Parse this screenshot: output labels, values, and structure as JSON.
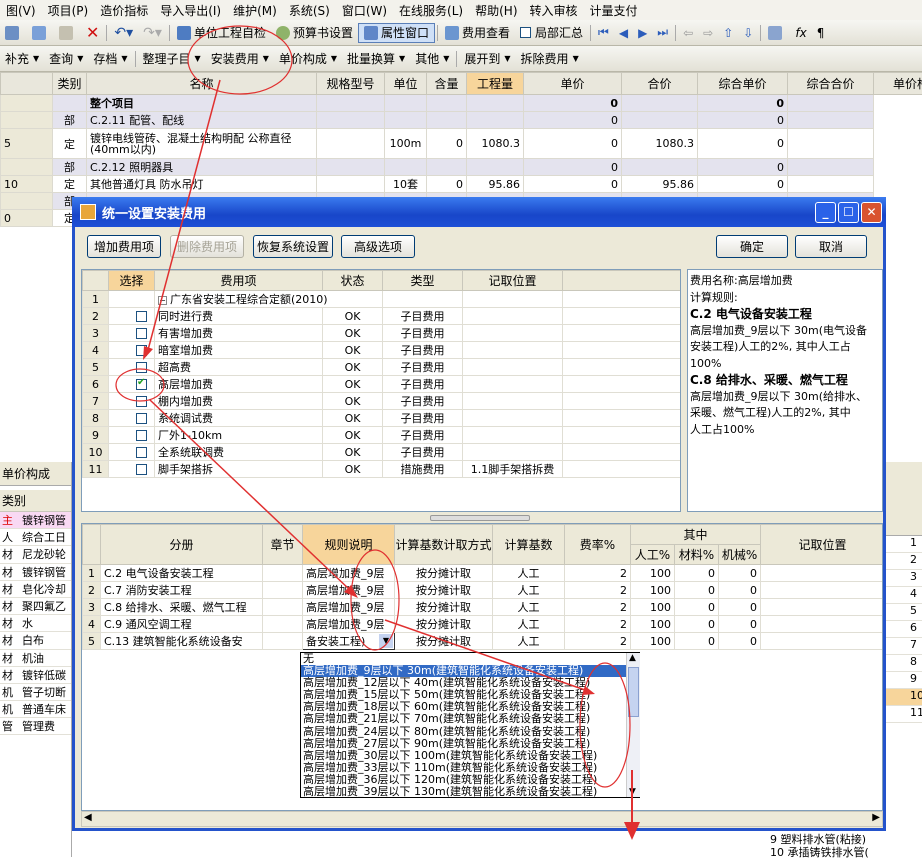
{
  "menu": [
    "图(V)",
    "项目(P)",
    "造价指标",
    "导入导出(I)",
    "维护(M)",
    "系统(S)",
    "窗口(W)",
    "在线服务(L)",
    "帮助(H)",
    "转入审核",
    "计量支付"
  ],
  "toolbar1": {
    "self_check": "单位工程自检",
    "budget_settings": "预算书设置",
    "property_window": "属性窗口",
    "fee_view": "费用查看",
    "local_summary": "局部汇总"
  },
  "toolbar2": {
    "items": [
      "补充",
      "查询",
      "存档",
      "整理子目",
      "安装费用",
      "单价构成",
      "批量换算",
      "其他",
      "展开到",
      "拆除费用"
    ]
  },
  "main_table": {
    "headers": [
      "类别",
      "名称",
      "规格型号",
      "单位",
      "含量",
      "工程量",
      "单价",
      "合价",
      "综合单价",
      "综合合价",
      "单价构成"
    ],
    "rows": [
      {
        "no": "",
        "cat": "",
        "name": "整个项目",
        "spec": "",
        "unit": "",
        "qty": "",
        "price": "",
        "total": "0",
        "cprice": "",
        "ctotal": "0",
        "bold": true
      },
      {
        "no": "",
        "cat": "部",
        "name": "C.2.11 配管、配线",
        "spec": "",
        "unit": "",
        "qty": "",
        "price": "",
        "total": "0",
        "cprice": "",
        "ctotal": "0"
      },
      {
        "no": "5",
        "cat": "定",
        "name": "镀锌电线管砖、混凝土结构明配 公称直径(40mm以内)",
        "spec": "",
        "unit": "100m",
        "qty": "0",
        "price": "1080.3",
        "total": "0",
        "cprice": "1080.3",
        "ctotal": "0"
      },
      {
        "no": "",
        "cat": "部",
        "name": "C.2.12 照明器具",
        "spec": "",
        "unit": "",
        "qty": "",
        "price": "",
        "total": "0",
        "cprice": "",
        "ctotal": "0"
      },
      {
        "no": "10",
        "cat": "定",
        "name": "其他普通灯具 防水吊灯",
        "spec": "",
        "unit": "10套",
        "qty": "0",
        "price": "95.86",
        "total": "0",
        "cprice": "95.86",
        "ctotal": "0"
      },
      {
        "no": "",
        "cat": "部",
        "name": "",
        "spec": "",
        "unit": "",
        "qty": "",
        "price": "",
        "total": "",
        "cprice": "",
        "ctotal": ""
      },
      {
        "no": "0",
        "cat": "定",
        "name": "",
        "spec": "",
        "unit": "",
        "qty": "",
        "price": "",
        "total": "",
        "cprice": "",
        "ctotal": ""
      }
    ]
  },
  "left_panel": {
    "tab": "单价构成",
    "header": "类别",
    "rows": [
      [
        "主",
        "镀锌钢管"
      ],
      [
        "人",
        "综合工日"
      ],
      [
        "材",
        "尼龙砂轮"
      ],
      [
        "材",
        "镀锌钢管"
      ],
      [
        "材",
        "皂化冷却"
      ],
      [
        "材",
        "聚四氟乙"
      ],
      [
        "材",
        "水"
      ],
      [
        "材",
        "白布"
      ],
      [
        "材",
        "机油"
      ],
      [
        "材",
        "镀锌低碳"
      ],
      [
        "机",
        "管子切断"
      ],
      [
        "机",
        "普通车床"
      ],
      [
        "管",
        "管理费"
      ]
    ]
  },
  "right_panel": {
    "numbers": [
      "1",
      "2",
      "3",
      "4",
      "5",
      "6",
      "7",
      "8",
      "9",
      "10",
      "11"
    ],
    "tree": [
      "9 塑料排水管(粘接)",
      "10 承插铸铁排水管("
    ]
  },
  "dialog": {
    "title": "统一设置安装费用",
    "buttons": {
      "add": "增加费用项",
      "delete": "删除费用项",
      "restore": "恢复系统设置",
      "advanced": "高级选项",
      "ok": "确定",
      "cancel": "取消"
    },
    "top_headers": [
      "选择",
      "费用项",
      "状态",
      "类型",
      "记取位置"
    ],
    "top_rows": [
      {
        "n": "1",
        "name": "广东省安装工程综合定额(2010)",
        "status": "",
        "type": "",
        "pos": "",
        "group": true
      },
      {
        "n": "2",
        "name": "同时进行费",
        "status": "OK",
        "type": "子目费用",
        "pos": "",
        "checked": false
      },
      {
        "n": "3",
        "name": "有害增加费",
        "status": "OK",
        "type": "子目费用",
        "pos": "",
        "checked": false
      },
      {
        "n": "4",
        "name": "暗室增加费",
        "status": "OK",
        "type": "子目费用",
        "pos": "",
        "checked": false
      },
      {
        "n": "5",
        "name": "超高费",
        "status": "OK",
        "type": "子目费用",
        "pos": "",
        "checked": false
      },
      {
        "n": "6",
        "name": "高层增加费",
        "status": "OK",
        "type": "子目费用",
        "pos": "",
        "checked": true
      },
      {
        "n": "7",
        "name": "棚内增加费",
        "status": "OK",
        "type": "子目费用",
        "pos": "",
        "checked": false
      },
      {
        "n": "8",
        "name": "系统调试费",
        "status": "OK",
        "type": "子目费用",
        "pos": "",
        "checked": false
      },
      {
        "n": "9",
        "name": "厂外1-10km",
        "status": "OK",
        "type": "子目费用",
        "pos": "",
        "checked": false
      },
      {
        "n": "10",
        "name": "全系统联调费",
        "status": "OK",
        "type": "子目费用",
        "pos": "",
        "checked": false
      },
      {
        "n": "11",
        "name": "脚手架搭拆",
        "status": "OK",
        "type": "措施费用",
        "pos": "1.1脚手架搭拆费",
        "checked": false
      }
    ],
    "info_lines": [
      {
        "t": "费用名称:高层增加费",
        "b": false
      },
      {
        "t": "计算规则:",
        "b": false
      },
      {
        "t": "C.2 电气设备安装工程",
        "b": true
      },
      {
        "t": "高层增加费_9层以下 30m(电气设备",
        "b": false
      },
      {
        "t": "安装工程)人工的2%, 其中人工占",
        "b": false
      },
      {
        "t": "100%",
        "b": false
      },
      {
        "t": "C.8 给排水、采暖、燃气工程",
        "b": true
      },
      {
        "t": "高层增加费_9层以下 30m(给排水、",
        "b": false
      },
      {
        "t": "采暖、燃气工程)人工的2%, 其中",
        "b": false
      },
      {
        "t": "人工占100%",
        "b": false
      }
    ],
    "bottom_headers": {
      "book": "分册",
      "chapter": "章节",
      "rule": "规则说明",
      "method": "计算基数计取方式",
      "base": "计算基数",
      "rate": "费率%",
      "among": "其中",
      "labor": "人工%",
      "material": "材料%",
      "machine": "机械%",
      "pos": "记取位置"
    },
    "bottom_rows": [
      {
        "n": "1",
        "book": "C.2 电气设备安装工程",
        "rule": "高层增加费_9层",
        "method": "按分摊计取",
        "base": "人工",
        "rate": "2",
        "labor": "100",
        "material": "0",
        "machine": "0"
      },
      {
        "n": "2",
        "book": "C.7 消防安装工程",
        "rule": "高层增加费_9层",
        "method": "按分摊计取",
        "base": "人工",
        "rate": "2",
        "labor": "100",
        "material": "0",
        "machine": "0"
      },
      {
        "n": "3",
        "book": "C.8 给排水、采暖、燃气工程",
        "rule": "高层增加费_9层",
        "method": "按分摊计取",
        "base": "人工",
        "rate": "2",
        "labor": "100",
        "material": "0",
        "machine": "0"
      },
      {
        "n": "4",
        "book": "C.9 通风空调工程",
        "rule": "高层增加费_9层",
        "method": "按分摊计取",
        "base": "人工",
        "rate": "2",
        "labor": "100",
        "material": "0",
        "machine": "0"
      },
      {
        "n": "5",
        "book": "C.13 建筑智能化系统设备安",
        "rule": "备安装工程)",
        "method": "按分摊计取",
        "base": "人工",
        "rate": "2",
        "labor": "100",
        "material": "0",
        "machine": "0"
      }
    ],
    "dropdown": [
      "无",
      "高层增加费_9层以下 30m(建筑智能化系统设备安装工程)",
      "高层增加费_12层以下 40m(建筑智能化系统设备安装工程)",
      "高层增加费_15层以下 50m(建筑智能化系统设备安装工程)",
      "高层增加费_18层以下 60m(建筑智能化系统设备安装工程)",
      "高层增加费_21层以下 70m(建筑智能化系统设备安装工程)",
      "高层增加费_24层以下 80m(建筑智能化系统设备安装工程)",
      "高层增加费_27层以下 90m(建筑智能化系统设备安装工程)",
      "高层增加费_30层以下 100m(建筑智能化系统设备安装工程)",
      "高层增加费_33层以下 110m(建筑智能化系统设备安装工程)",
      "高层增加费_36层以下 120m(建筑智能化系统设备安装工程)",
      "高层增加费_39层以下 130m(建筑智能化系统设备安装工程)"
    ],
    "dropdown_selected": 1
  }
}
